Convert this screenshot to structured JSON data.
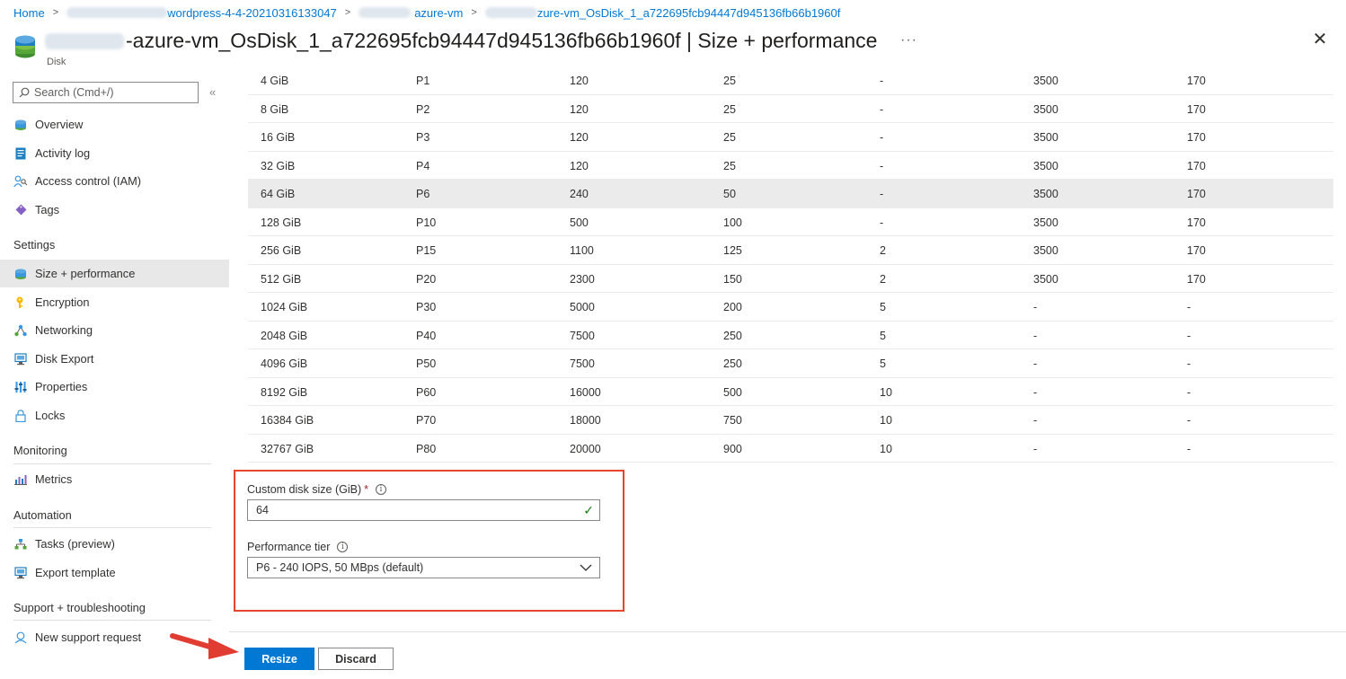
{
  "breadcrumb": {
    "home": "Home",
    "item1": "wordpress-4-4-20210316133047",
    "item2": "azure-vm",
    "item3": "zure-vm_OsDisk_1_a722695fcb94447d945136fb66b1960f"
  },
  "header": {
    "title": "-azure-vm_OsDisk_1_a722695fcb94447d945136fb66b1960f | Size + performance",
    "subtitle": "Disk",
    "more": "···",
    "close": "✕"
  },
  "sidebar": {
    "search_placeholder": "Search (Cmd+/)",
    "collapse": "«",
    "items": [
      {
        "label": "Overview",
        "icon": "disk-icon"
      },
      {
        "label": "Activity log",
        "icon": "log-icon"
      },
      {
        "label": "Access control (IAM)",
        "icon": "iam-icon"
      },
      {
        "label": "Tags",
        "icon": "tag-icon"
      },
      {
        "label": "Size + performance",
        "icon": "disk-icon"
      },
      {
        "label": "Encryption",
        "icon": "key-icon"
      },
      {
        "label": "Networking",
        "icon": "network-icon"
      },
      {
        "label": "Disk Export",
        "icon": "export-icon"
      },
      {
        "label": "Properties",
        "icon": "properties-icon"
      },
      {
        "label": "Locks",
        "icon": "lock-icon"
      },
      {
        "label": "Metrics",
        "icon": "metrics-icon"
      },
      {
        "label": "Tasks (preview)",
        "icon": "tasks-icon"
      },
      {
        "label": "Export template",
        "icon": "template-icon"
      },
      {
        "label": "New support request",
        "icon": "support-icon"
      }
    ],
    "sections": {
      "settings": "Settings",
      "monitoring": "Monitoring",
      "automation": "Automation",
      "support": "Support + troubleshooting"
    }
  },
  "table": {
    "rows": [
      [
        "4 GiB",
        "P1",
        "120",
        "25",
        "-",
        "3500",
        "170"
      ],
      [
        "8 GiB",
        "P2",
        "120",
        "25",
        "-",
        "3500",
        "170"
      ],
      [
        "16 GiB",
        "P3",
        "120",
        "25",
        "-",
        "3500",
        "170"
      ],
      [
        "32 GiB",
        "P4",
        "120",
        "25",
        "-",
        "3500",
        "170"
      ],
      [
        "64 GiB",
        "P6",
        "240",
        "50",
        "-",
        "3500",
        "170"
      ],
      [
        "128 GiB",
        "P10",
        "500",
        "100",
        "-",
        "3500",
        "170"
      ],
      [
        "256 GiB",
        "P15",
        "1100",
        "125",
        "2",
        "3500",
        "170"
      ],
      [
        "512 GiB",
        "P20",
        "2300",
        "150",
        "2",
        "3500",
        "170"
      ],
      [
        "1024 GiB",
        "P30",
        "5000",
        "200",
        "5",
        "-",
        "-"
      ],
      [
        "2048 GiB",
        "P40",
        "7500",
        "250",
        "5",
        "-",
        "-"
      ],
      [
        "4096 GiB",
        "P50",
        "7500",
        "250",
        "5",
        "-",
        "-"
      ],
      [
        "8192 GiB",
        "P60",
        "16000",
        "500",
        "10",
        "-",
        "-"
      ],
      [
        "16384 GiB",
        "P70",
        "18000",
        "750",
        "10",
        "-",
        "-"
      ],
      [
        "32767 GiB",
        "P80",
        "20000",
        "900",
        "10",
        "-",
        "-"
      ]
    ],
    "selected_index": 4
  },
  "form": {
    "custom_size_label": "Custom disk size (GiB)",
    "required_mark": "*",
    "custom_size_value": "64",
    "tier_label": "Performance tier",
    "tier_value": "P6 - 240 IOPS, 50 MBps (default)",
    "info_glyph": "i",
    "check_glyph": "✓"
  },
  "footer": {
    "resize_label": "Resize",
    "discard_label": "Discard"
  },
  "colors": {
    "accent": "#0078d4",
    "highlight_border": "#e8452e",
    "arrow": "#e03c31"
  }
}
